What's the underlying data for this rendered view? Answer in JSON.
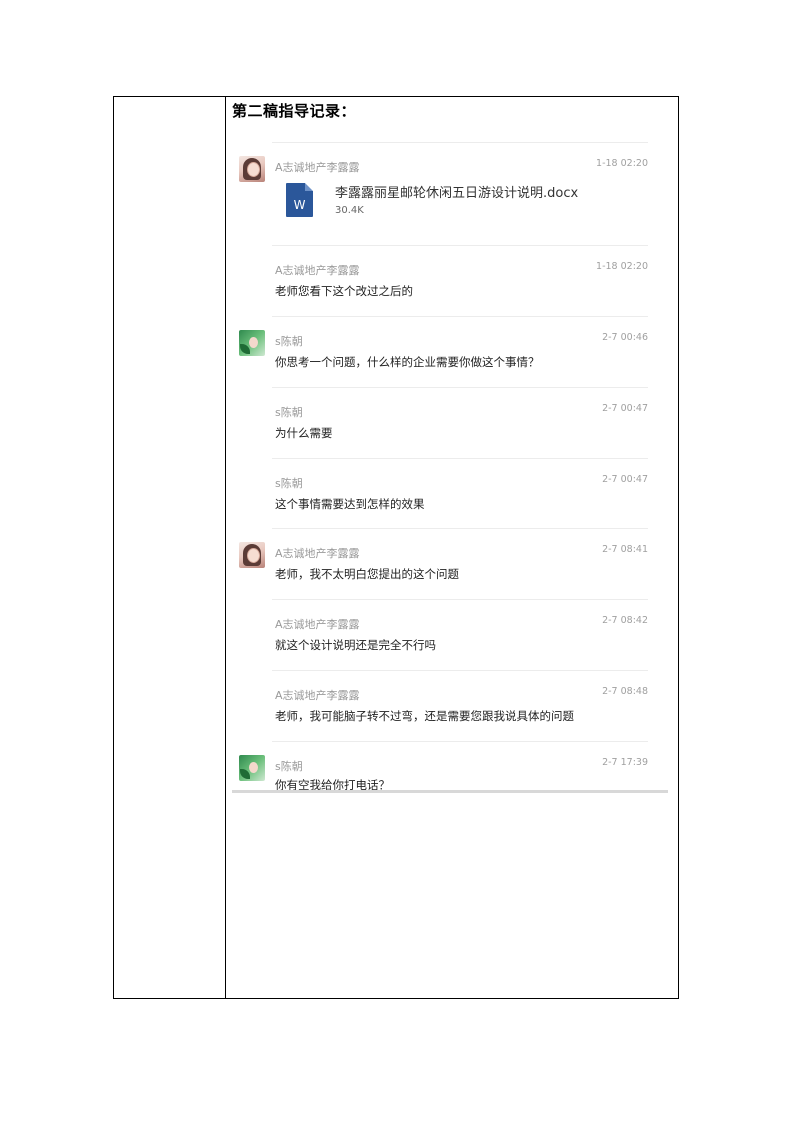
{
  "section_title": "第二稿指导记录：",
  "messages": [
    {
      "sender": "A志诚地产李露露",
      "time": "1-18 02:20",
      "avatar": "girl",
      "text": "",
      "file": {
        "name": "李露露丽星邮轮休闲五日游设计说明.docx",
        "size": "30.4K",
        "icon": "word-icon",
        "icon_letter": "W"
      }
    },
    {
      "sender": "A志诚地产李露露",
      "time": "1-18 02:20",
      "avatar": "",
      "text": "老师您看下这个改过之后的"
    },
    {
      "sender": "s陈朝",
      "time": "2-7 00:46",
      "avatar": "green",
      "text": "你思考一个问题，什么样的企业需要你做这个事情？"
    },
    {
      "sender": "s陈朝",
      "time": "2-7 00:47",
      "avatar": "",
      "text": "为什么需要"
    },
    {
      "sender": "s陈朝",
      "time": "2-7 00:47",
      "avatar": "",
      "text": "这个事情需要达到怎样的效果"
    },
    {
      "sender": "A志诚地产李露露",
      "time": "2-7 08:41",
      "avatar": "girl",
      "text": "老师，我不太明白您提出的这个问题"
    },
    {
      "sender": "A志诚地产李露露",
      "time": "2-7 08:42",
      "avatar": "",
      "text": "就这个设计说明还是完全不行吗"
    },
    {
      "sender": "A志诚地产李露露",
      "time": "2-7 08:48",
      "avatar": "",
      "text": "老师，我可能脑子转不过弯，还是需要您跟我说具体的问题"
    },
    {
      "sender": "s陈朝",
      "time": "2-7 17:39",
      "avatar": "green",
      "text": "你有空我给你打电话？"
    }
  ]
}
